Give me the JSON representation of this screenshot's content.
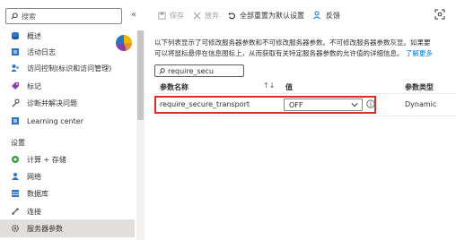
{
  "sidebar": {
    "search_placeholder": "搜索",
    "collapse_glyph": "«",
    "items_top": [
      {
        "label": "概述",
        "icon": "overview-icon",
        "color": "#2d74c4"
      },
      {
        "label": "活动日志",
        "icon": "activity-log-icon",
        "color": "#2d74c4"
      },
      {
        "label": "访问控制(标识和访问管理)",
        "icon": "access-control-icon",
        "color": "#2d74c4"
      },
      {
        "label": "标记",
        "icon": "tag-icon",
        "color": "#8a3fa6"
      },
      {
        "label": "诊断并解决问题",
        "icon": "wrench-icon",
        "color": "#605e5c"
      },
      {
        "label": "Learning center",
        "icon": "learning-center-icon",
        "color": "#2d74c4"
      }
    ],
    "section_settings": "设置",
    "items_settings": [
      {
        "label": "计算 + 存储",
        "icon": "compute-storage-icon",
        "color": "#3aa03a"
      },
      {
        "label": "网络",
        "icon": "network-icon",
        "color": "#2d74c4"
      },
      {
        "label": "数据库",
        "icon": "database-icon",
        "color": "#2d74c4"
      },
      {
        "label": "连接",
        "icon": "connect-icon",
        "color": "#605e5c"
      },
      {
        "label": "服务器参数",
        "icon": "gear-icon",
        "color": "#605e5c",
        "selected": true
      }
    ]
  },
  "toolbar": {
    "save_label": "保存",
    "discard_label": "放弃",
    "reset_label": "全部重置为默认设置",
    "feedback_label": "反馈"
  },
  "description": {
    "line1": "以下列表显示了可修改服务器参数和不可修改服务器参数。不可修改服务器参数灰显。如果要",
    "line2": "可以将鼠标悬停在信息图标上，从而获取有关特定服务器参数的允许值的详细信息。",
    "link": "了解更多"
  },
  "filter": {
    "value": "require_secu"
  },
  "table": {
    "headers": {
      "name": "参数名称",
      "value": "值",
      "type": "参数类型"
    },
    "sort_glyph": "↑↓",
    "rows": [
      {
        "name": "require_secure_transport",
        "value": "OFF",
        "type": "Dynamic"
      }
    ]
  },
  "colors": {
    "accent": "#0078d4",
    "highlight": "#e02b2b",
    "selected_bg": "#e1dfdd"
  }
}
